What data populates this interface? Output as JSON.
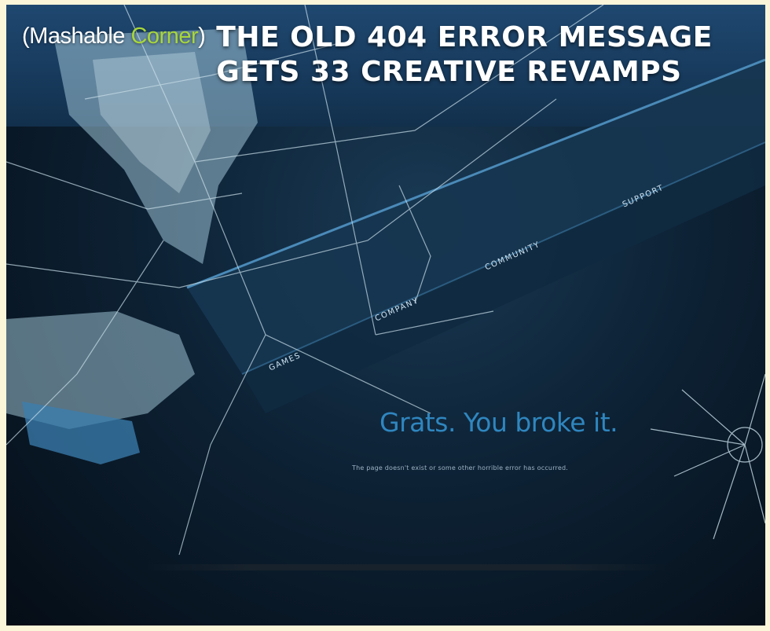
{
  "header": {
    "brand_open": "(Mashable ",
    "brand_accent": "Corner",
    "brand_close": ")",
    "headline_line1": "THE OLD 404 ERROR MESSAGE",
    "headline_line2": "GETS 33 CREATIVE REVAMPS"
  },
  "nav": {
    "games": "GAMES",
    "company": "COMPANY",
    "community": "COMMUNITY",
    "support": "SUPPORT"
  },
  "error": {
    "title": "Grats. You broke it.",
    "message": "The page doesn't exist or some other horrible error has occurred."
  },
  "colors": {
    "accent_green": "#a7d63b",
    "error_blue": "#2f86bf",
    "page_border": "#fbf6d9"
  }
}
